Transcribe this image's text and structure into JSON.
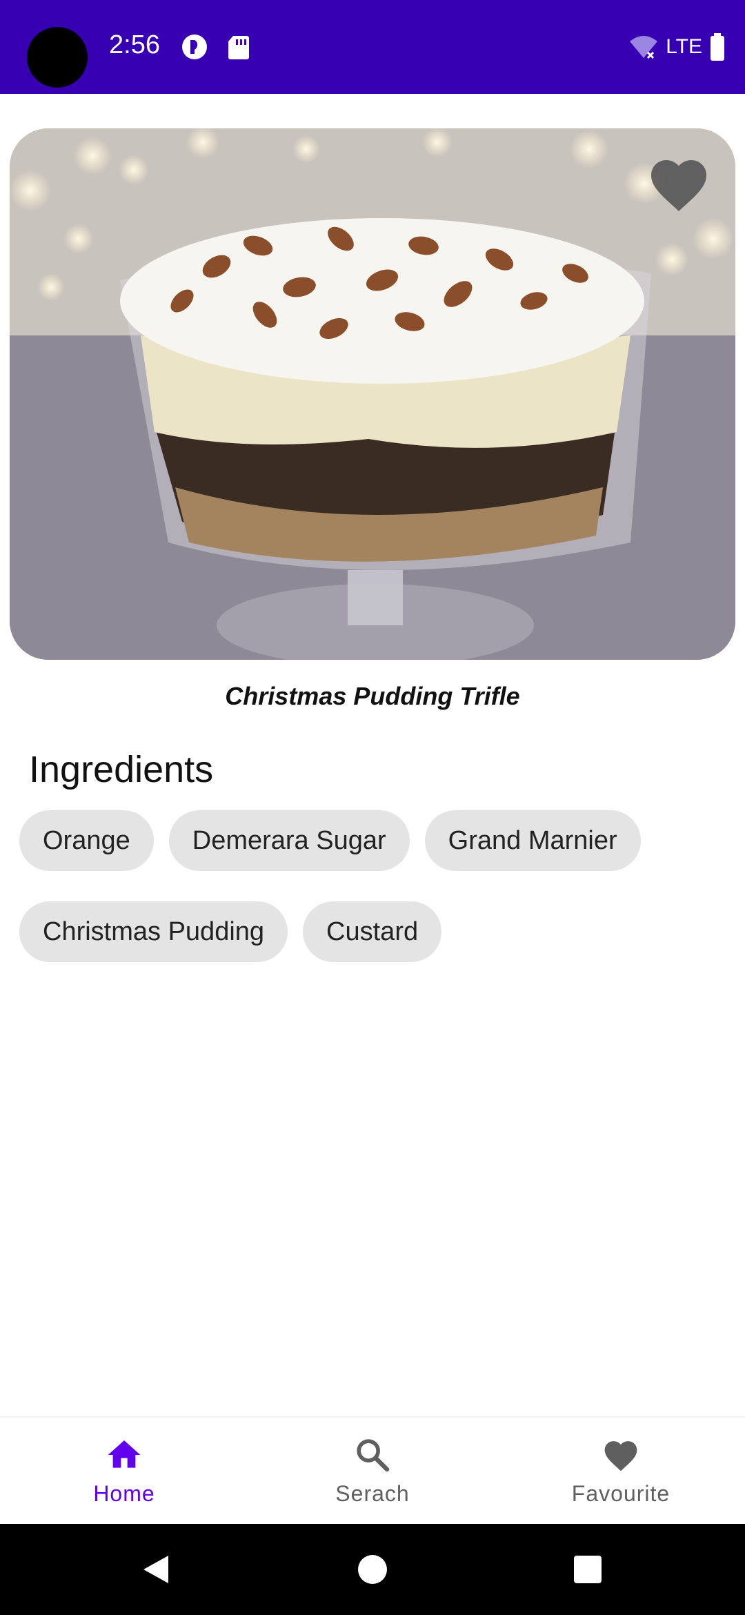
{
  "status_bar": {
    "time": "2:56",
    "network": "LTE",
    "icons": [
      "camera-cutout",
      "data-saver-icon",
      "sd-card-icon",
      "wifi-off-icon",
      "battery-icon"
    ]
  },
  "recipe": {
    "title": "Christmas Pudding Trifle",
    "favourite_icon": "heart-icon"
  },
  "ingredients": {
    "title": "Ingredients",
    "rows": [
      [
        "Orange",
        "Demerara Sugar",
        "Grand Marnier"
      ],
      [
        "Christmas Pudding",
        "Custard"
      ]
    ]
  },
  "bottom_nav": {
    "items": [
      {
        "label": "Home",
        "icon": "home-icon",
        "active": true
      },
      {
        "label": "Serach",
        "icon": "search-icon",
        "active": false
      },
      {
        "label": "Favourite",
        "icon": "heart-icon",
        "active": false
      }
    ]
  },
  "colors": {
    "status_bar": "#3700b3",
    "accent": "#6200ee",
    "chip_bg": "#e4e4e4"
  }
}
